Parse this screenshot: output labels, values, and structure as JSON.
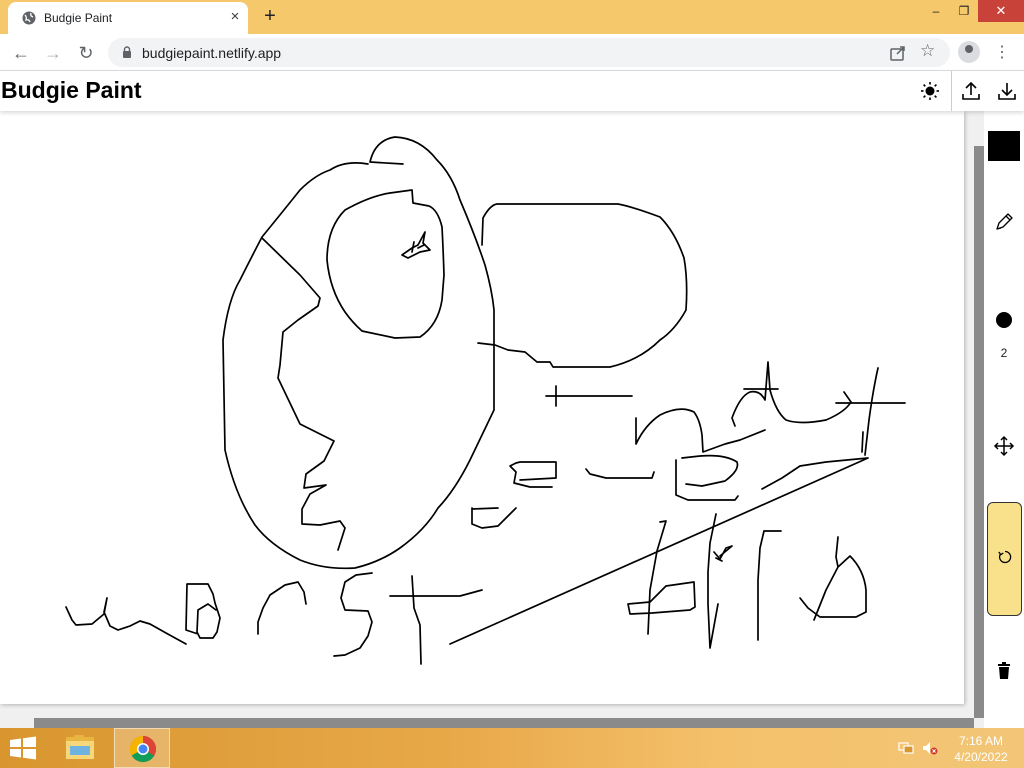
{
  "browser": {
    "tab_title": "Budgie Paint",
    "tab_close_icon": "×",
    "new_tab_icon": "+",
    "url": "budgiepaint.netlify.app",
    "window_controls": {
      "minimize": "‒",
      "maximize": "❐",
      "close": "✕"
    }
  },
  "app": {
    "title": "Budgie Paint",
    "header_buttons": [
      "theme-toggle-icon",
      "upload-icon",
      "download-icon"
    ]
  },
  "tools": {
    "selected_color": "#000000",
    "brush_size": "2",
    "undo_color": "#f9e08b"
  },
  "taskbar": {
    "time": "7:16 AM",
    "date": "4/20/2022"
  },
  "colors": {
    "titlebar": "#f5c96b",
    "canvas": "#ffffff",
    "stroke": "#000000"
  }
}
